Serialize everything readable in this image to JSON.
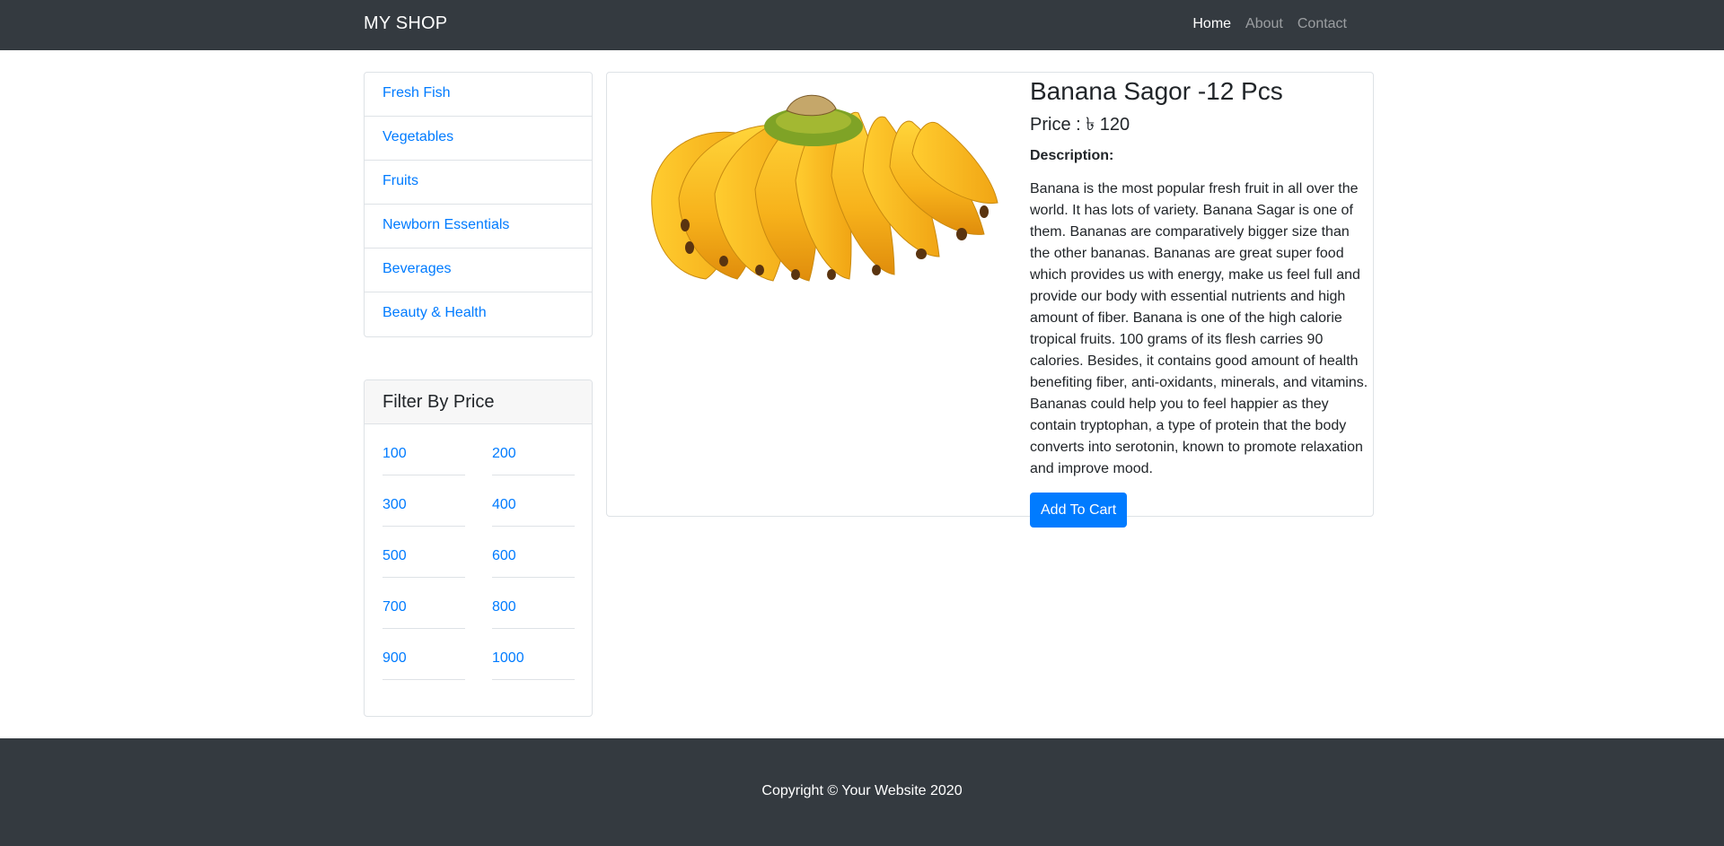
{
  "navbar": {
    "brand": "MY SHOP",
    "links": [
      {
        "label": "Home",
        "active": true
      },
      {
        "label": "About",
        "active": false
      },
      {
        "label": "Contact",
        "active": false
      }
    ]
  },
  "categories": [
    "Fresh Fish",
    "Vegetables",
    "Fruits",
    "Newborn Essentials",
    "Beverages",
    "Beauty & Health"
  ],
  "filter": {
    "title": "Filter By Price",
    "prices": [
      "100",
      "200",
      "300",
      "400",
      "500",
      "600",
      "700",
      "800",
      "900",
      "1000"
    ]
  },
  "product": {
    "image_name": "banana-bunch-image",
    "title": "Banana Sagor -12 Pcs",
    "price": "Price : ৳ 120",
    "description_label": "Description:",
    "description": "Banana is the most popular fresh fruit in all over the world. It has lots of variety. Banana Sagar is one of them. Bananas are comparatively bigger size than the other bananas. Bananas are great super food which provides us with energy, make us feel full and provide our body with essential nutrients and high amount of fiber. Banana is one of the high calorie tropical fruits. 100 grams of its flesh carries 90 calories. Besides, it contains good amount of health benefiting fiber, anti-oxidants, minerals, and vitamins. Bananas could help you to feel happier as they contain tryptophan, a type of protein that the body converts into serotonin, known to promote relaxation and improve mood.",
    "button": "Add To Cart"
  },
  "footer": {
    "copyright": "Copyright © Your Website 2020"
  },
  "colors": {
    "navbar": "#343a40",
    "link": "#007bff",
    "button": "#007bff",
    "border": "#dee2e6"
  }
}
